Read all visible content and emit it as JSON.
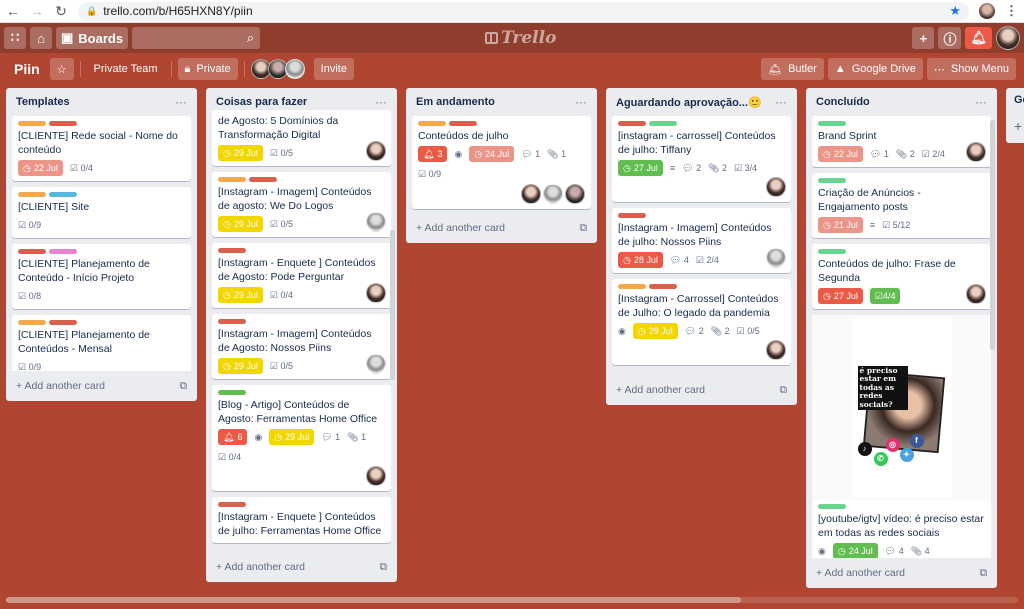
{
  "browser": {
    "url": "trello.com/b/H65HXN8Y/piin",
    "back": "←",
    "forward": "→",
    "reload": "C"
  },
  "topbar": {
    "boards_label": "Boards",
    "logo_text": "Trello",
    "icons": [
      "apps-grid-icon",
      "home-icon",
      "boards-icon",
      "search-icon",
      "plus-icon",
      "info-icon",
      "bell-icon"
    ]
  },
  "board": {
    "name": "Piin",
    "team_label": "Private Team",
    "visibility_label": "Private",
    "invite_label": "Invite",
    "butler_label": "Butler",
    "drive_label": "Google Drive",
    "menu_label": "Show Menu",
    "add_card_label": "Add another card"
  },
  "colors": {
    "board_bg": "#b04632",
    "label_orange": "#f2a84b",
    "label_red": "#d9604f",
    "label_blue": "#55b9d9",
    "label_pink": "#e882d2",
    "label_green": "#6ad48e",
    "label_lime": "#61bd4f"
  },
  "lists": [
    {
      "name": "Templates",
      "cards": [
        {
          "labels": [
            "orange",
            "red"
          ],
          "title": "[CLIENTE] Rede social - Nome do conteúdo",
          "due": "22 Jul",
          "due_status": "overdue",
          "checklist": "0/4"
        },
        {
          "labels": [
            "orange",
            "blue"
          ],
          "title": "[CLIENTE] Site",
          "checklist": "0/9"
        },
        {
          "labels": [
            "red",
            "pink"
          ],
          "title": "[CLIENTE] Planejamento de Conteúdo - Início Projeto",
          "checklist": "0/8"
        },
        {
          "labels": [
            "orange",
            "red"
          ],
          "title": "[CLIENTE] Planejamento de Conteúdos - Mensal",
          "checklist": "0/9"
        }
      ]
    },
    {
      "name": "Coisas para fazer",
      "cards": [
        {
          "labels": [],
          "title": "de Agosto: 5 Domínios da Transformação Digital",
          "due": "29 Jul",
          "due_status": "yellow",
          "checklist": "0/5",
          "member": true
        },
        {
          "labels": [
            "orange",
            "red"
          ],
          "title": "[Instagram - Imagem] Conteúdos de agosto: We Do Logos",
          "due": "29 Jul",
          "due_status": "yellow",
          "checklist": "0/5",
          "member": true
        },
        {
          "labels": [
            "red"
          ],
          "title": "[Instagram - Enquete ] Conteúdos de Agosto: Pode Perguntar",
          "due": "29 Jul",
          "due_status": "yellow",
          "checklist": "0/4",
          "member": true
        },
        {
          "labels": [
            "red"
          ],
          "title": "[Instagram - Imagem] Conteúdos de Agosto: Nossos Piins",
          "due": "29 Jul",
          "due_status": "yellow",
          "checklist": "0/5",
          "member": true
        },
        {
          "labels": [
            "lime"
          ],
          "title": "[Blog - Artigo] Conteúdos de Agosto: Ferramentas Home Office",
          "notifications": "6",
          "watching": true,
          "due": "29 Jul",
          "due_status": "yellow",
          "comments": "1",
          "attachments": "1",
          "checklist": "0/4",
          "member": true
        },
        {
          "labels": [
            "red"
          ],
          "title": "[Instagram - Enquete ] Conteúdos de julho: Ferramentas Home Office"
        }
      ]
    },
    {
      "name": "Em andamento",
      "cards": [
        {
          "labels": [
            "orange",
            "red"
          ],
          "title": "Conteúdos de julho",
          "notifications": "3",
          "watching": true,
          "due": "24 Jul",
          "due_status": "overdue",
          "comments": "1",
          "attachments": "1",
          "checklist": "0/9",
          "members": 3
        }
      ]
    },
    {
      "name": "Aguardando aprovação...",
      "emoji": "🙂",
      "cards": [
        {
          "labels": [
            "red",
            "green"
          ],
          "title": "[instagram - carrossel] Conteúdos de julho: Tiffany",
          "due": "27 Jul",
          "due_status": "green",
          "description": true,
          "comments": "2",
          "attachments": "2",
          "checklist": "3/4",
          "member": true
        },
        {
          "labels": [
            "red"
          ],
          "title": "[Instagram - Imagem] Conteúdos de julho: Nossos Piins",
          "due": "28 Jul",
          "due_status": "red",
          "comments": "4",
          "checklist": "2/4",
          "member": true
        },
        {
          "labels": [
            "orange",
            "red"
          ],
          "title": "[Instagram - Carrossel] Conteúdos de Julho: O legado da pandemia",
          "watching": true,
          "due": "29 Jul",
          "due_status": "yellow",
          "comments": "2",
          "attachments": "2",
          "checklist": "0/5",
          "member": true
        }
      ]
    },
    {
      "name": "Concluído",
      "cards": [
        {
          "labels": [
            "green"
          ],
          "title": "Brand Sprint",
          "due": "22 Jul",
          "due_status": "overdue",
          "comments": "1",
          "attachments": "2",
          "checklist": "2/4",
          "member": true
        },
        {
          "labels": [
            "green"
          ],
          "title": "Criação de Anúncios - Engajamento posts",
          "due": "21 Jul",
          "due_status": "overdue",
          "description": true,
          "checklist": "5/12"
        },
        {
          "labels": [
            "green"
          ],
          "title": "Conteúdos de julho: Frase de Segunda",
          "due": "27 Jul",
          "due_status": "red",
          "checklist": "4/4",
          "checklist_done": true,
          "member": true
        },
        {
          "labels": [
            "green"
          ],
          "title": "[youtube/igtv] vídeo: é preciso estar em todas as redes sociais",
          "cover_text": "é preciso estar em todas as redes sociais?",
          "watching": true,
          "due": "24 Jul",
          "due_status": "green",
          "comments": "4",
          "attachments": "4"
        }
      ]
    },
    {
      "name": "Ge"
    }
  ]
}
